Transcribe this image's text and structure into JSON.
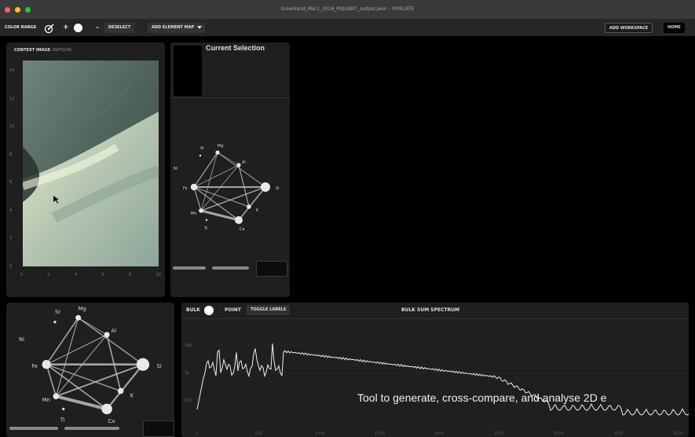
{
  "window": {
    "title": "Greenland_Mar1_2018_PIQUANT_output.jeon – PIXELATE",
    "traffic_lights": [
      "#ff5f57",
      "#febc2e",
      "#28c840"
    ]
  },
  "toolbar": {
    "color_range_label": "COLOR RANGE",
    "plus_label": "+",
    "minus_label": "–",
    "deselect_label": "DESELECT",
    "add_element_map_label": "ADD ELEMENT MAP",
    "add_workspace_label": "ADD WORKSPACE",
    "home_label": "HOME"
  },
  "context_panel": {
    "title": "CONTEXT IMAGE",
    "subtitle": "(WATSON)",
    "y_ticks": [
      "14",
      "12",
      "10",
      "8",
      "6",
      "4",
      "2",
      "0"
    ],
    "x_ticks": [
      "0",
      "2",
      "4",
      "6",
      "8",
      "10"
    ]
  },
  "selection_panel": {
    "title": "Current Selection"
  },
  "element_graph": {
    "labels": [
      "Sr",
      "Mg",
      "Ni",
      "Al",
      "Fe",
      "Si",
      "Mn",
      "K",
      "Ti",
      "Ca"
    ]
  },
  "spectrum_panel": {
    "bulk_label": "BULK",
    "point_label": "POINT",
    "toggle_labels": "TOGGLE LABELS",
    "title": "BULK SUM SPECTRUM",
    "y_ticks": [
      "10k",
      "1k",
      "100"
    ],
    "x_ticks": [
      "0",
      "500",
      "1000",
      "1500",
      "2000",
      "2500",
      "3000",
      "3500",
      "4000"
    ]
  },
  "overlay": {
    "caption": "Tool to generate, cross-compare, and analyse 2D e"
  },
  "colors": {
    "selection_highlight": "#ffffff",
    "panel_background": "#1f1f1f"
  }
}
